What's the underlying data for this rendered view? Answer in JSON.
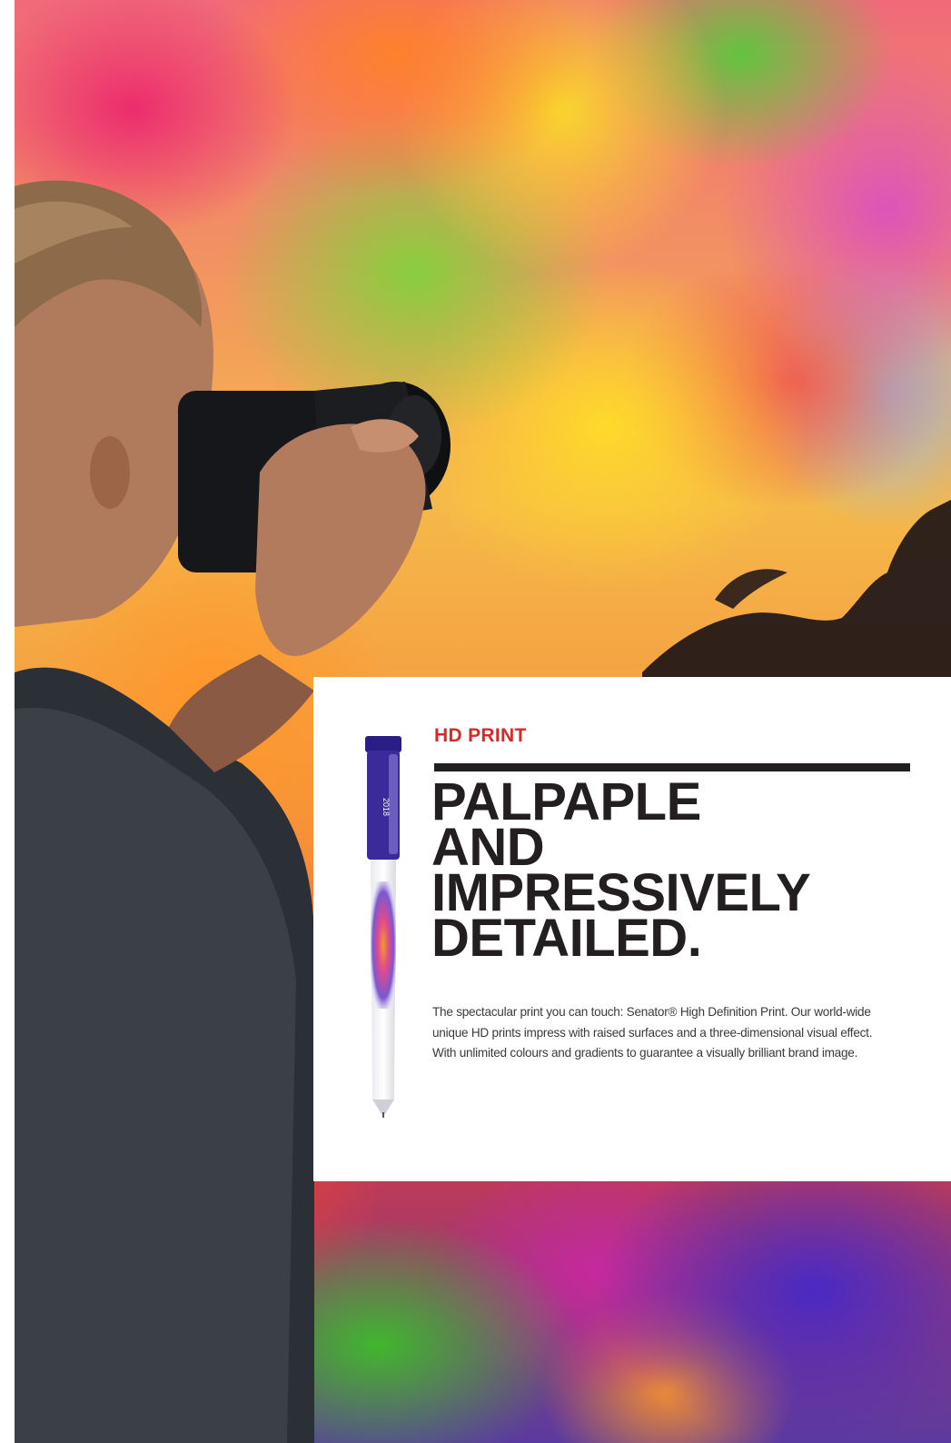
{
  "colors": {
    "eyebrow": "#d42a2a",
    "headline": "#231f20",
    "rule": "#231f20",
    "card": "#ffffff",
    "pen_clip": "#3b2a9a"
  },
  "card": {
    "eyebrow": "HD PRINT",
    "headline_lines": [
      "PALPAPLE",
      "AND",
      "IMPRESSIVELY",
      "DETAILED."
    ],
    "body_lines": [
      "The spectacular print you can touch: Senator® High Definition Print. Our world-wide",
      "unique HD prints impress with raised surfaces and a three-dimensional visual effect.",
      "With unlimited colours and gradients to guarantee a visually brilliant brand image."
    ]
  },
  "pen": {
    "clip_text": "2018",
    "icon": "pen-product-image"
  },
  "background": {
    "icon": "photographer-colour-powder-photo"
  }
}
